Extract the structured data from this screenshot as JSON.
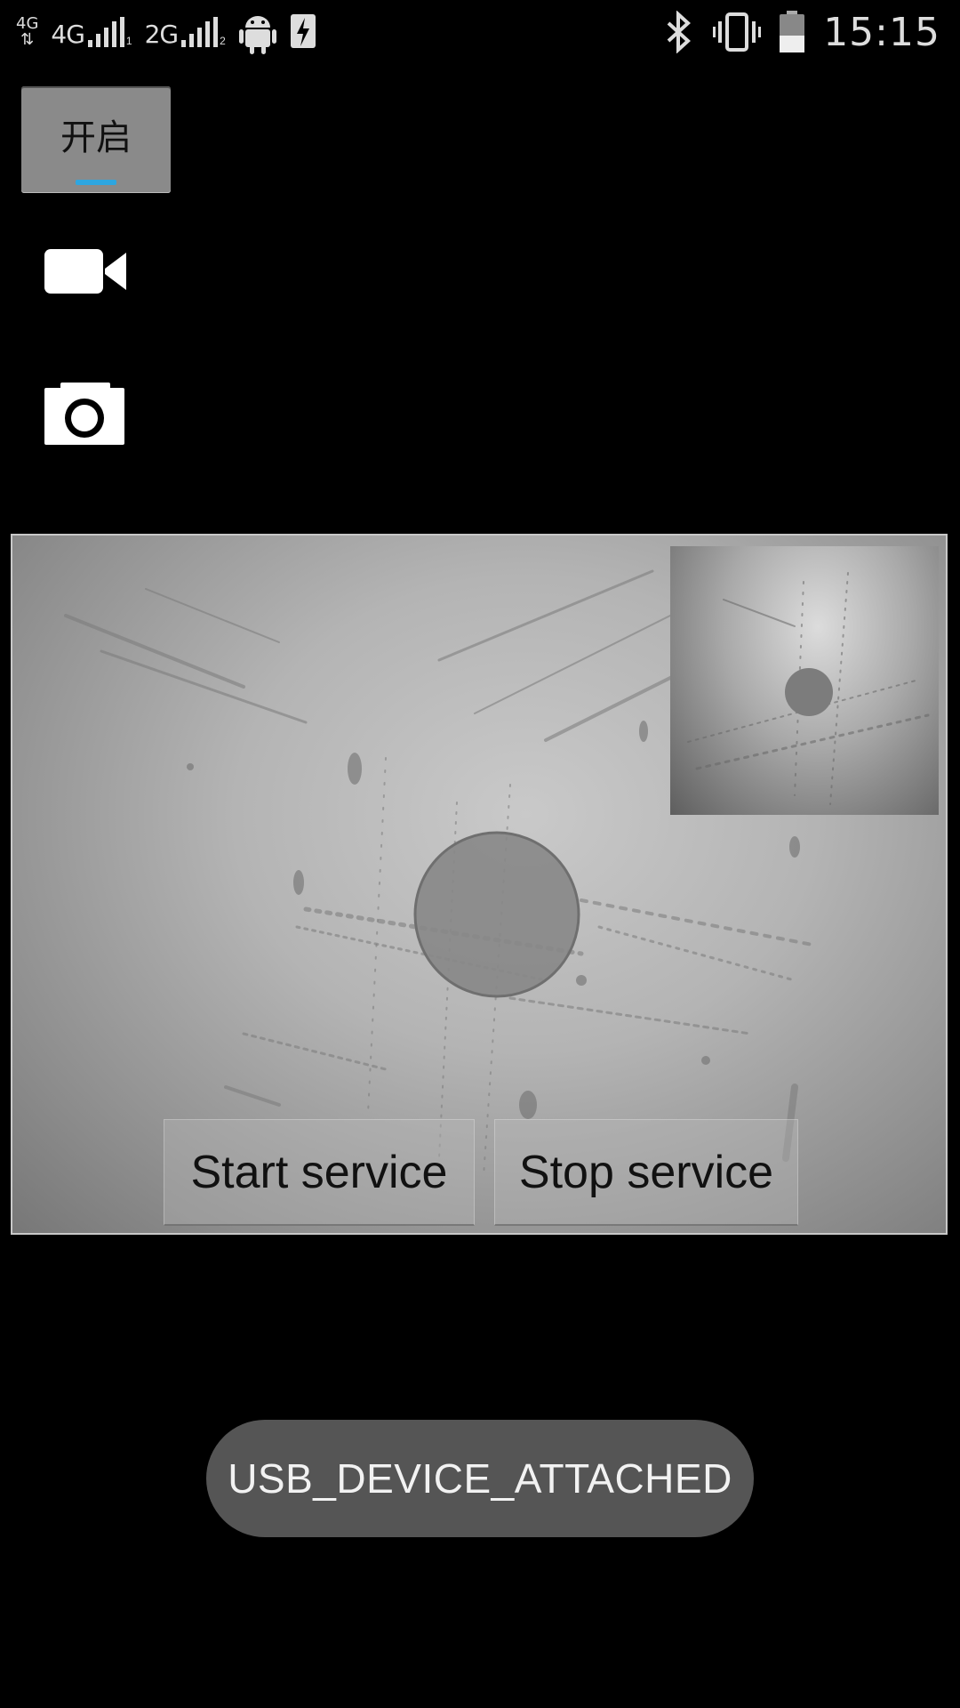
{
  "status_bar": {
    "network_type_mini": "4G",
    "sim1": {
      "type": "4G",
      "slot": "1"
    },
    "sim2": {
      "type": "2G",
      "slot": "2"
    },
    "icons": [
      "signal-icon",
      "android-icon",
      "charging-icon",
      "bluetooth-icon",
      "vibrate-icon",
      "battery-icon"
    ],
    "time": "15:15"
  },
  "controls": {
    "toggle_label": "开启",
    "toggle_indicator_color": "#2ea6e0",
    "video_icon": "video-camera-icon",
    "photo_icon": "camera-icon"
  },
  "preview": {
    "start_service_label": "Start service",
    "stop_service_label": "Stop service"
  },
  "toast": {
    "message": "USB_DEVICE_ATTACHED"
  }
}
